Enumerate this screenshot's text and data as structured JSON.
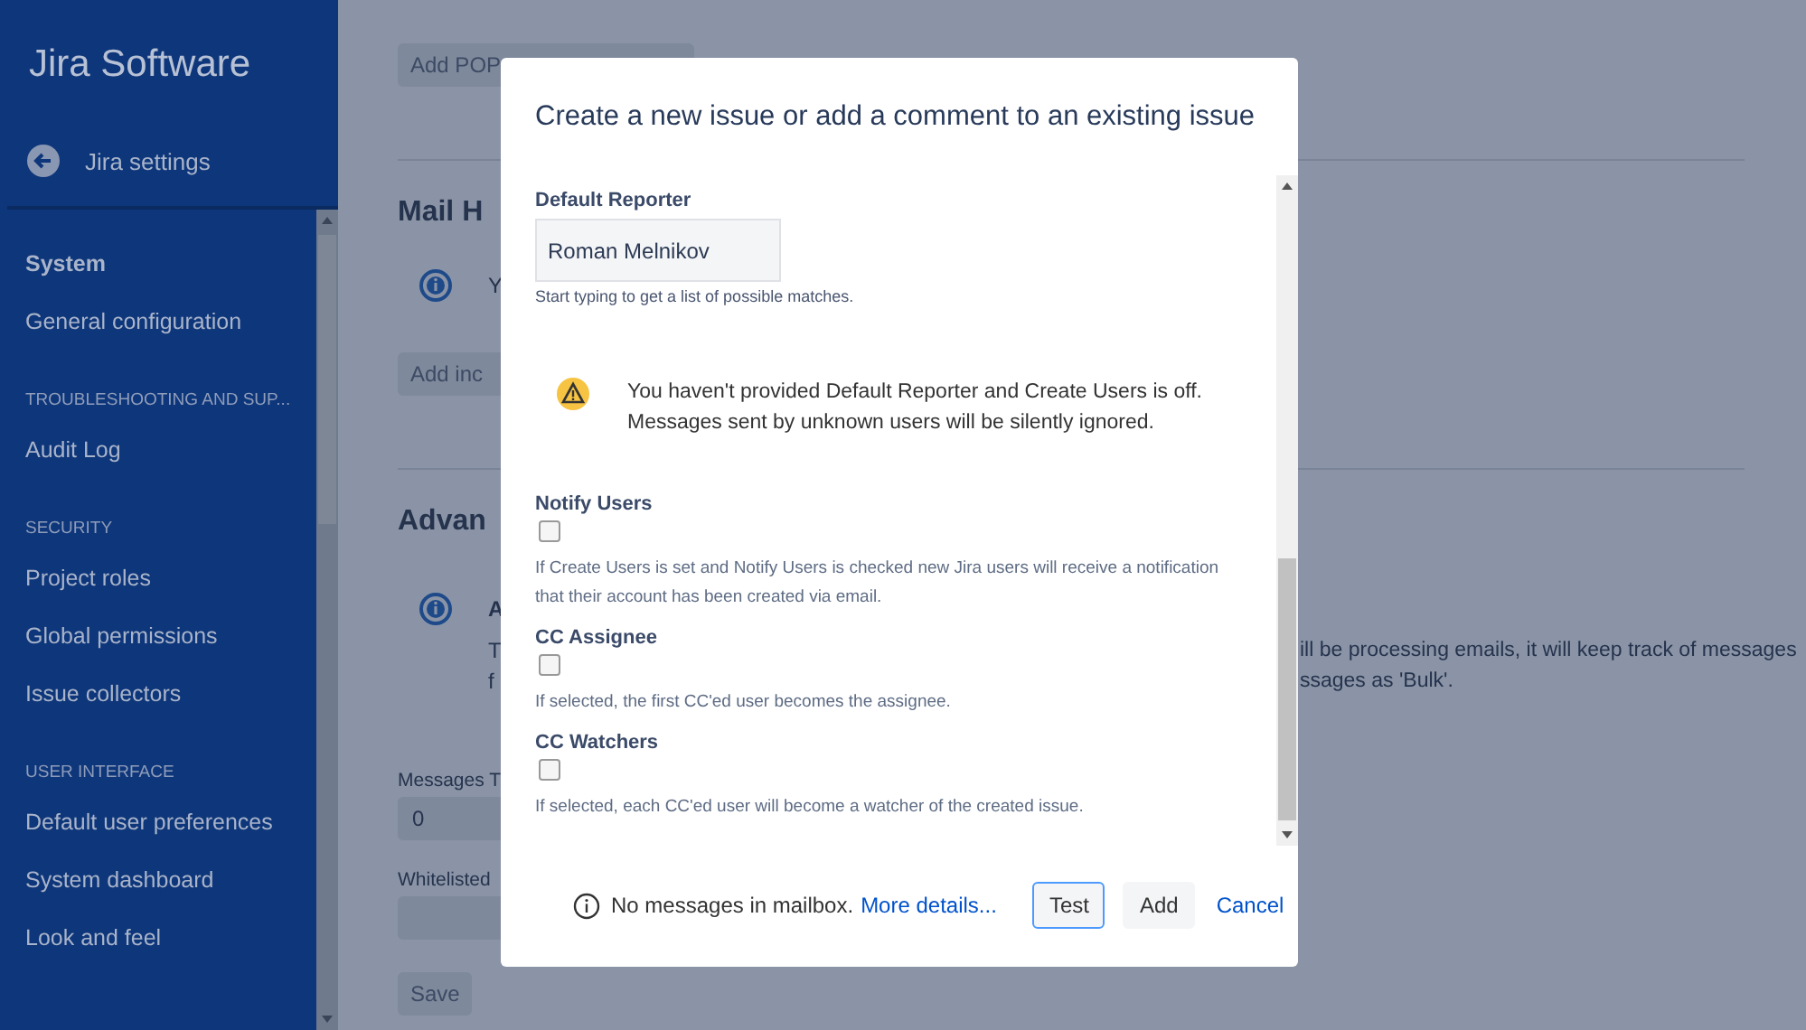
{
  "sidebar": {
    "title": "Jira Software",
    "back_link": "Jira settings",
    "sections": [
      {
        "items": [
          {
            "label": "System",
            "selected": true
          },
          {
            "label": "General configuration",
            "selected": false
          }
        ]
      },
      {
        "heading": "TROUBLESHOOTING AND SUP...",
        "items": [
          {
            "label": "Audit Log",
            "selected": false
          }
        ]
      },
      {
        "heading": "SECURITY",
        "items": [
          {
            "label": "Project roles",
            "selected": false
          },
          {
            "label": "Global permissions",
            "selected": false
          },
          {
            "label": "Issue collectors",
            "selected": false
          }
        ]
      },
      {
        "heading": "USER INTERFACE",
        "items": [
          {
            "label": "Default user preferences",
            "selected": false
          },
          {
            "label": "System dashboard",
            "selected": false
          },
          {
            "label": "Look and feel",
            "selected": false
          }
        ]
      }
    ]
  },
  "page": {
    "add_pop_button": "Add POP",
    "mail_handlers_heading": "Mail H",
    "mail_handlers_info": "Y",
    "add_incoming_button": "Add inc",
    "advanced_heading": "Advan",
    "advanced_info_title": "A",
    "advanced_info_lines": [
      {
        "left": "T",
        "right": "ill be processing emails, it will keep track of messages"
      },
      {
        "left": "f",
        "right": "ssages as 'Bulk'."
      }
    ],
    "messages_label": "Messages T",
    "messages_value": "0",
    "whitelisted_label": "Whitelisted",
    "save_button": "Save"
  },
  "modal": {
    "title": "Create a new issue or add a comment to an existing issue",
    "reporter_label": "Default Reporter",
    "reporter_value": "Roman Melnikov",
    "reporter_help": "Start typing to get a list of possible matches.",
    "warning": "You haven't provided Default Reporter and Create Users is off. Messages sent by unknown users will be silently ignored.",
    "options": [
      {
        "label": "Notify Users",
        "checked": false,
        "help": "If Create Users is set and Notify Users is checked new Jira users will receive a notification that their account has been created via email."
      },
      {
        "label": "CC Assignee",
        "checked": false,
        "help": "If selected, the first CC'ed user becomes the assignee."
      },
      {
        "label": "CC Watchers",
        "checked": false,
        "help": "If selected, each CC'ed user will become a watcher of the created issue."
      }
    ],
    "status": "No messages in mailbox.",
    "status_link": "More details...",
    "buttons": [
      {
        "label": "Test",
        "kind": "focused"
      },
      {
        "label": "Add",
        "kind": "default"
      },
      {
        "label": "Cancel",
        "kind": "link"
      }
    ]
  }
}
